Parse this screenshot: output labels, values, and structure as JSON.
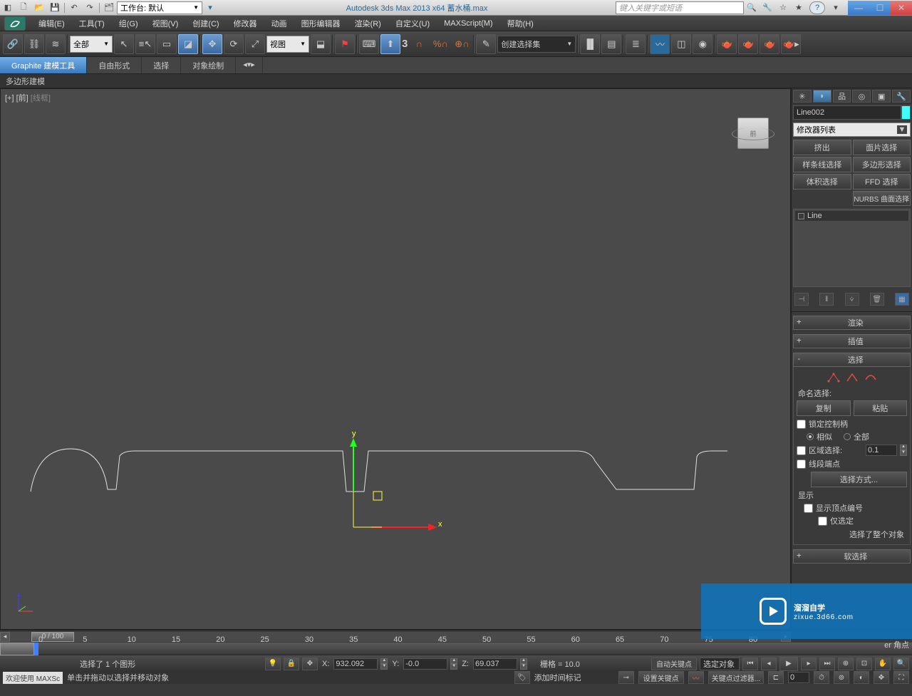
{
  "titlebar": {
    "workspace_label": "工作台: 默认",
    "app_title": "Autodesk 3ds Max  2013 x64     蓄水桶.max",
    "search_placeholder": "键入关键字或短语"
  },
  "menu": [
    "编辑(E)",
    "工具(T)",
    "组(G)",
    "视图(V)",
    "创建(C)",
    "修改器",
    "动画",
    "图形编辑器",
    "渲染(R)",
    "自定义(U)",
    "MAXScript(M)",
    "帮助(H)"
  ],
  "toolbar": {
    "filter_all": "全部",
    "ref_sys": "视图",
    "three": "3",
    "create_set": "创建选择集"
  },
  "ribbon": {
    "tabs": [
      "Graphite 建模工具",
      "自由形式",
      "选择",
      "对象绘制"
    ],
    "sub": "多边形建模"
  },
  "viewport": {
    "label_prefix": "[+] [前] ",
    "label_mode": "[线框]",
    "cube_face": "前",
    "gizmo": {
      "x": "x",
      "y": "y"
    }
  },
  "panel": {
    "object_name": "Line002",
    "mod_list_label": "修改器列表",
    "set_buttons": [
      "挤出",
      "面片选择",
      "样条线选择",
      "多边形选择",
      "体积选择",
      "FFD 选择"
    ],
    "nurbs_btn": "NURBS 曲面选择",
    "stack_item": "Line",
    "rollouts": {
      "render": "渲染",
      "interp": "插值",
      "select": "选择",
      "soft": "软选择"
    },
    "named_sel": "命名选择:",
    "copy": "复制",
    "paste": "粘贴",
    "lock_handles": "锁定控制柄",
    "similar": "相似",
    "all": "全部",
    "area_sel": "区域选择:",
    "area_val": "0.1",
    "seg_end": "线段端点",
    "sel_method": "选择方式...",
    "display": "显示",
    "show_vert_num": "显示顶点编号",
    "only_sel": "仅选定",
    "sel_msg": "选择了整个对象",
    "bez_corner": "er 角点"
  },
  "timeslider": {
    "label": "0 / 100"
  },
  "ruler_ticks": [
    "0",
    "5",
    "10",
    "15",
    "20",
    "25",
    "30",
    "35",
    "40",
    "45",
    "50",
    "55",
    "60",
    "65",
    "70",
    "75",
    "80"
  ],
  "status": {
    "sel_text": "选择了 1 个图形",
    "x": "932.092",
    "y": "-0.0",
    "z": "69.037",
    "grid": "栅格 = 10.0",
    "auto_key": "自动关键点",
    "sel_lock": "选定对象",
    "set_key": "设置关键点",
    "key_filter": "关键点过滤器...",
    "frame0": "0"
  },
  "status2": {
    "welcome": "欢迎使用  MAXSc",
    "hint": "单击并拖动以选择并移动对象",
    "add_time": "添加时间标记"
  },
  "watermark": {
    "big": "溜溜自学",
    "small": "zixue.3d66.com"
  }
}
